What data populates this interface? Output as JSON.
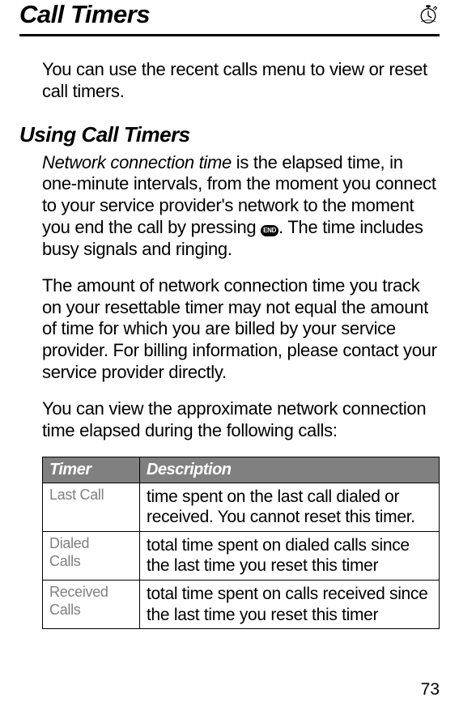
{
  "header": {
    "title": "Call Timers",
    "icon_name": "stopwatch-icon"
  },
  "intro": "You can use the recent calls menu to view or reset call timers.",
  "section_title": "Using Call Timers",
  "p1_a": "Network connection time",
  "p1_b": " is the elapsed time, in one-minute intervals, from the moment you connect to your service provider's network to the moment you end the call by pressing ",
  "end_label": "END",
  "p1_c": ". The time includes busy signals and ringing.",
  "p2": "The amount of network connection time you track on your resettable timer may not equal the amount of time for which you are billed by your service provider. For billing information, please contact your service provider directly.",
  "p3": "You can view the approximate network connection time elapsed during the following calls:",
  "table": {
    "col1": "Timer",
    "col2": "Description",
    "rows": [
      {
        "name": "Last Call",
        "desc": "time spent on the last call dialed or received. You cannot reset this timer."
      },
      {
        "name": "Dialed\nCalls",
        "desc": "total time spent on dialed calls since the last time you reset this timer"
      },
      {
        "name": "Received\nCalls",
        "desc": "total time spent on calls received since the last time you reset this timer"
      }
    ]
  },
  "page_number": "73"
}
